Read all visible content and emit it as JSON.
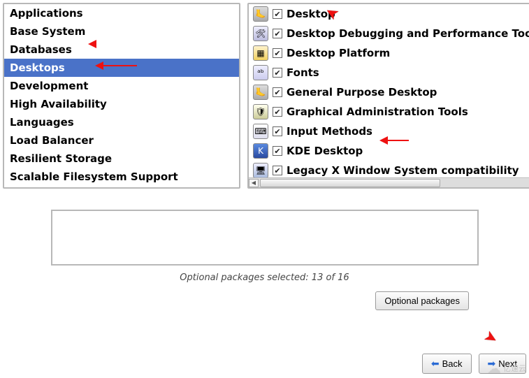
{
  "categories": [
    {
      "label": "Applications",
      "selected": false
    },
    {
      "label": "Base System",
      "selected": false
    },
    {
      "label": "Databases",
      "selected": false
    },
    {
      "label": "Desktops",
      "selected": true
    },
    {
      "label": "Development",
      "selected": false
    },
    {
      "label": "High Availability",
      "selected": false
    },
    {
      "label": "Languages",
      "selected": false
    },
    {
      "label": "Load Balancer",
      "selected": false
    },
    {
      "label": "Resilient Storage",
      "selected": false
    },
    {
      "label": "Scalable Filesystem Support",
      "selected": false
    }
  ],
  "packages": [
    {
      "label": "Desktop",
      "checked": true,
      "icon": "foot"
    },
    {
      "label": "Desktop Debugging and Performance Tools",
      "checked": true,
      "icon": "tools"
    },
    {
      "label": "Desktop Platform",
      "checked": true,
      "icon": "platform"
    },
    {
      "label": "Fonts",
      "checked": true,
      "icon": "fonts"
    },
    {
      "label": "General Purpose Desktop",
      "checked": true,
      "icon": "foot"
    },
    {
      "label": "Graphical Administration Tools",
      "checked": true,
      "icon": "shield"
    },
    {
      "label": "Input Methods",
      "checked": true,
      "icon": "keyboard"
    },
    {
      "label": "KDE Desktop",
      "checked": true,
      "icon": "kde"
    },
    {
      "label": "Legacy X Window System compatibility",
      "checked": true,
      "icon": "monitor"
    }
  ],
  "icon_glyphs": {
    "foot": "🦶",
    "tools": "🛠",
    "platform": "▦",
    "fonts": "ᵃᵇ",
    "shield": "🛡",
    "keyboard": "⌨",
    "kde": "K",
    "monitor": "🖥"
  },
  "optional_text": "Optional packages selected: 13 of 16",
  "buttons": {
    "optional": "Optional packages",
    "back": "Back",
    "next": "Next"
  },
  "watermark": "亿速云"
}
